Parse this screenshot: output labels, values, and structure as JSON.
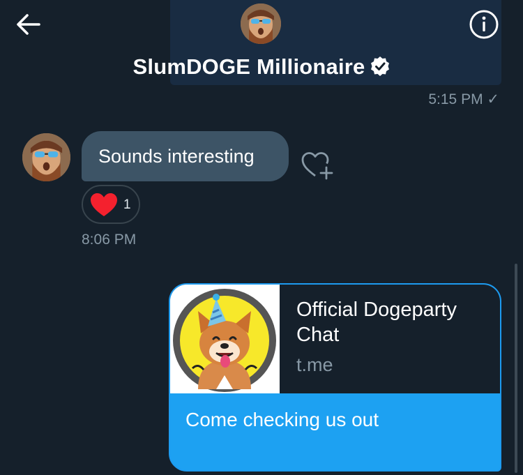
{
  "header": {
    "title": "SlumDOGE Millionaire",
    "back_icon": "arrow-left-icon",
    "info_icon": "info-circle-icon",
    "verified_icon": "verified-badge-icon"
  },
  "messages": {
    "sent_time": "5:15 PM ✓",
    "incoming": {
      "text": "Sounds interesting",
      "time": "8:06 PM",
      "reaction_count": "1",
      "reaction_icon": "heart-icon",
      "add_reaction_icon": "heart-plus-icon"
    },
    "outgoing_link": {
      "title": "Official Dogeparty Chat",
      "domain": "t.me",
      "message": "Come checking us out"
    }
  },
  "colors": {
    "background": "#15202b",
    "incoming_bubble": "#3d5466",
    "outgoing_bubble": "#1da1f2",
    "muted_text": "#8899a6",
    "heart": "#f4212e"
  }
}
